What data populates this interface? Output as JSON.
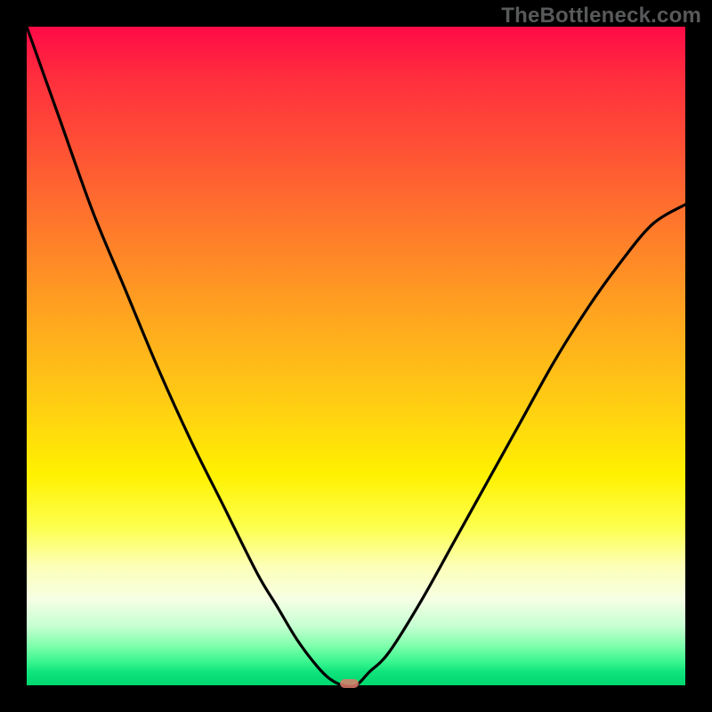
{
  "watermark": "TheBottleneck.com",
  "colors": {
    "frame": "#000000",
    "gradient_top": "#ff0a47",
    "gradient_mid": "#fff100",
    "gradient_bottom": "#00d86e",
    "curve": "#000000",
    "marker": "#e07a6a"
  },
  "chart_data": {
    "type": "line",
    "title": "",
    "xlabel": "",
    "ylabel": "",
    "x_range": [
      0,
      1
    ],
    "y_range": [
      0,
      1
    ],
    "series": [
      {
        "name": "bottleneck-curve",
        "x": [
          0.0,
          0.05,
          0.1,
          0.15,
          0.2,
          0.25,
          0.3,
          0.35,
          0.38,
          0.41,
          0.44,
          0.46,
          0.48,
          0.5,
          0.52,
          0.55,
          0.6,
          0.65,
          0.7,
          0.75,
          0.8,
          0.85,
          0.9,
          0.95,
          1.0
        ],
        "y": [
          1.0,
          0.86,
          0.72,
          0.6,
          0.48,
          0.37,
          0.27,
          0.17,
          0.12,
          0.07,
          0.03,
          0.01,
          0.0,
          0.0,
          0.02,
          0.05,
          0.13,
          0.22,
          0.31,
          0.4,
          0.49,
          0.57,
          0.64,
          0.7,
          0.73
        ]
      }
    ],
    "marker": {
      "x": 0.49,
      "y": 0.0,
      "width_frac": 0.028,
      "height_frac": 0.014
    },
    "notes": "No axis ticks or labels visible. y is plotted with origin at bottom (0) to top (1). Values estimated from pixel positions."
  }
}
